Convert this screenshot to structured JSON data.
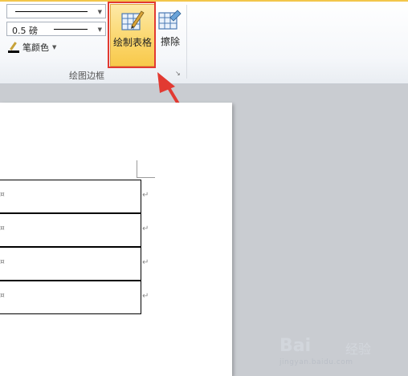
{
  "ribbon": {
    "line_style_combo": {
      "arrow_icon": "chevron-down-icon"
    },
    "line_weight_combo": {
      "value": "0.5 磅"
    },
    "pen_color": {
      "label": "笔颜色",
      "color": "#000000"
    },
    "draw_table": {
      "label": "绘制表格"
    },
    "eraser": {
      "label": "擦除"
    },
    "group_label": "绘图边框"
  },
  "document": {
    "rows": [
      {},
      {},
      {},
      {}
    ],
    "cell_marker": "¤",
    "end_of_row_marker": "↵"
  },
  "annotation": {
    "color": "#e23a32",
    "target": "draw_table"
  },
  "watermark": {
    "brand": "Bai",
    "brand_cn": "经验",
    "url": "jingyan.baidu.com"
  }
}
